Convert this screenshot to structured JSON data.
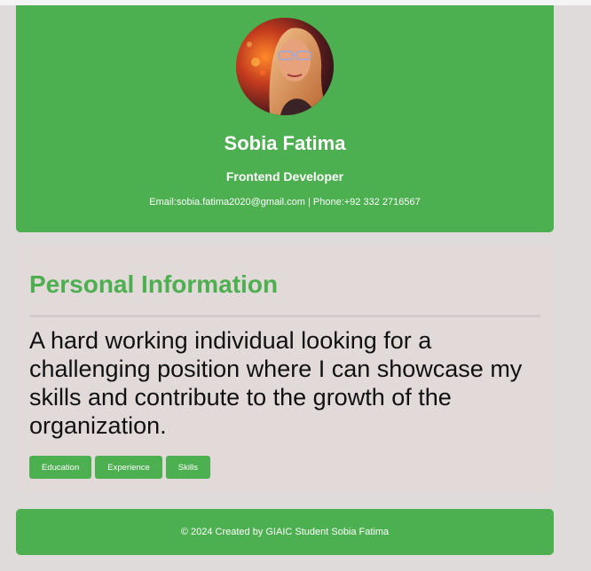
{
  "header": {
    "name": "Sobia Fatima",
    "role": "Frontend Developer",
    "contact": "Email:sobia.fatima2020@gmail.com | Phone:+92 332 2716567"
  },
  "personal": {
    "title": "Personal Information",
    "bio": "A hard working individual looking for a challenging position where I can showcase my skills and contribute to the growth of the organization.",
    "buttons": [
      "Education",
      "Experience",
      "Skills"
    ]
  },
  "footer": {
    "text": "© 2024 Created by GIAIC Student Sobia Fatima"
  },
  "colors": {
    "accent": "#4caf50",
    "background": "#e0dbdb"
  }
}
